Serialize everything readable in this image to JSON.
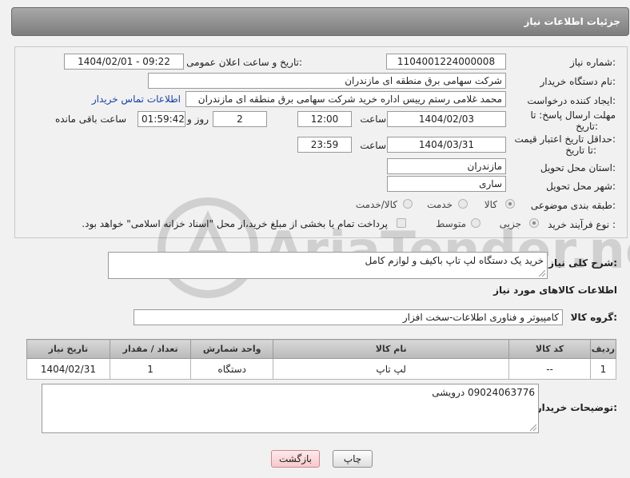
{
  "header": {
    "title": "جزئیات اطلاعات نیاز"
  },
  "form": {
    "need_number": {
      "label": "شماره نیاز:",
      "value": "1104001224000008"
    },
    "announce_datetime": {
      "label": "تاریخ و ساعت اعلان عمومی:",
      "value": "1404/02/01 - 09:22"
    },
    "buyer_org": {
      "label": "نام دستگاه خریدار:",
      "value": "شرکت سهامی برق منطقه ای مازندران"
    },
    "requester": {
      "label": "ایجاد کننده درخواست:",
      "value": "محمد غلامی رستم رییس اداره خرید شرکت سهامی برق منطقه ای مازندران",
      "contact_link": "اطلاعات تماس خریدار"
    },
    "reply_deadline": {
      "label_line1": "مهلت ارسال پاسخ: تا",
      "label_line2": "تاریخ:",
      "date": "1404/02/03",
      "time_label": "ساعت",
      "time": "12:00",
      "days": "2",
      "days_label": "روز و",
      "remaining": "01:59:42",
      "remaining_label": "ساعت باقی مانده"
    },
    "price_validity": {
      "label_line1": "حداقل تاریخ اعتبار قیمت:",
      "label_line2": "تا تاریخ:",
      "date": "1404/03/31",
      "time_label": "ساعت",
      "time": "23:59"
    },
    "delivery_province": {
      "label": "استان محل تحویل:",
      "value": "مازندران"
    },
    "delivery_city": {
      "label": "شهر محل تحویل:",
      "value": "ساری"
    },
    "category": {
      "label": "طبقه بندی موضوعی:",
      "options": [
        "کالا",
        "خدمت",
        "کالا/خدمت"
      ],
      "selected": "کالا"
    },
    "purchase_type": {
      "label": "نوع فرآیند خرید :",
      "options": [
        "جزیی",
        "متوسط"
      ],
      "selected": "جزیی",
      "payment_note": "پرداخت تمام یا بخشی از مبلغ خرید،از محل \"اسناد خزانه اسلامی\" خواهد بود."
    }
  },
  "description": {
    "label": "شرح کلی نیاز:",
    "value": "خرید یک دستگاه لپ تاپ باکیف و لوازم کامل"
  },
  "goods_section": {
    "title": "اطلاعات کالاهای مورد نیاز"
  },
  "goods_group": {
    "label": "گروه کالا:",
    "value": "کامپیوتر و فناوری اطلاعات-سخت افزار"
  },
  "table": {
    "headers": [
      "ردیف",
      "کد کالا",
      "نام کالا",
      "واحد شمارش",
      "تعداد / مقدار",
      "تاریخ نیاز"
    ],
    "rows": [
      [
        "1",
        "--",
        "لپ تاپ",
        "دستگاه",
        "1",
        "1404/02/31"
      ]
    ]
  },
  "buyer_notes": {
    "label": "توضیحات خریدار:",
    "value": "09024063776 درویشی"
  },
  "buttons": {
    "print": "چاپ",
    "back": "بازگشت"
  },
  "watermark": {
    "text": "AriaTender.net"
  }
}
